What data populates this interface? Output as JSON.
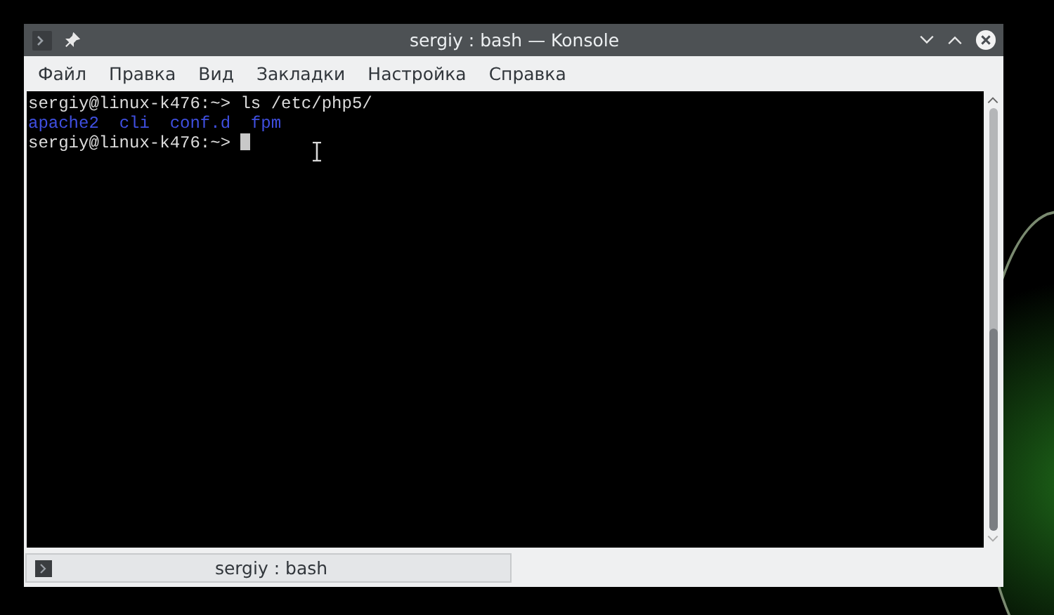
{
  "window": {
    "title": "sergiy : bash — Konsole"
  },
  "menu": [
    "Файл",
    "Правка",
    "Вид",
    "Закладки",
    "Настройка",
    "Справка"
  ],
  "terminal": {
    "lines": [
      {
        "kind": "command",
        "prompt": "sergiy@linux-k476:~>",
        "command": "ls /etc/php5/"
      },
      {
        "kind": "listing",
        "entries": [
          "apache2",
          "cli",
          "conf.d",
          "fpm"
        ]
      },
      {
        "kind": "input",
        "prompt": "sergiy@linux-k476:~>"
      }
    ]
  },
  "tabs": [
    {
      "label": "sergiy : bash"
    }
  ]
}
